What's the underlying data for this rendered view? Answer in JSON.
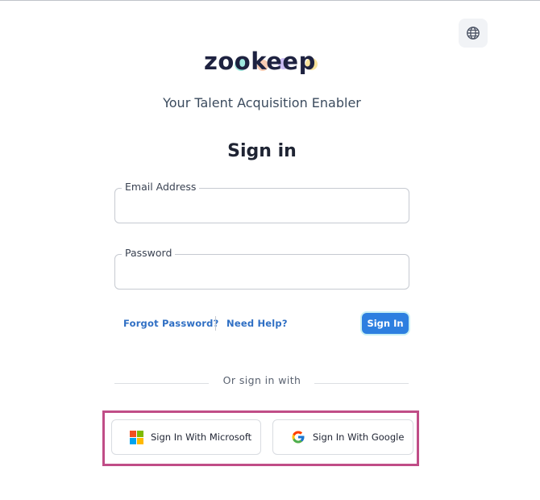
{
  "language_button": {
    "icon": "globe-icon"
  },
  "logo": {
    "text": "zookeep"
  },
  "tagline": "Your Talent Acquisition Enabler",
  "title": "Sign in",
  "form": {
    "email_label": "Email Address",
    "email_value": "",
    "password_label": "Password",
    "password_value": ""
  },
  "links": {
    "forgot_password": "Forgot Password?",
    "need_help": "Need Help?"
  },
  "signin_button": "Sign In",
  "divider_text": "Or sign in with",
  "sso": {
    "microsoft_label": "Sign In With Microsoft",
    "google_label": "Sign In With Google"
  },
  "colors": {
    "primary": "#2d7fe0",
    "highlight_frame": "#c04d87",
    "link": "#2f6fc4"
  }
}
